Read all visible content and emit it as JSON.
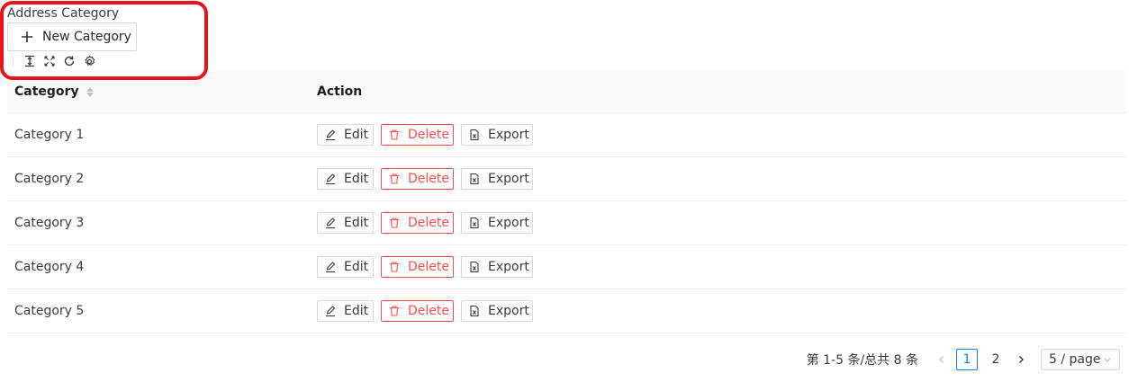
{
  "header": {
    "title": "Address Category",
    "new_button_label": "New Category"
  },
  "toolbar": {
    "icons": [
      "column-height-icon",
      "fullscreen-icon",
      "reload-icon",
      "settings-icon"
    ]
  },
  "table": {
    "columns": [
      "Category",
      "Action"
    ],
    "rows": [
      {
        "category": "Category 1"
      },
      {
        "category": "Category 2"
      },
      {
        "category": "Category 3"
      },
      {
        "category": "Category 4"
      },
      {
        "category": "Category 5"
      }
    ],
    "actions": {
      "edit": "Edit",
      "delete": "Delete",
      "export": "Export"
    }
  },
  "pagination": {
    "total_text": "第 1-5 条/总共 8 条",
    "pages": [
      "1",
      "2"
    ],
    "current_page": "1",
    "page_size": "5 / page"
  },
  "colors": {
    "danger": "#ff4d4f",
    "primary": "#1677ff",
    "highlight": "#e8141c"
  }
}
